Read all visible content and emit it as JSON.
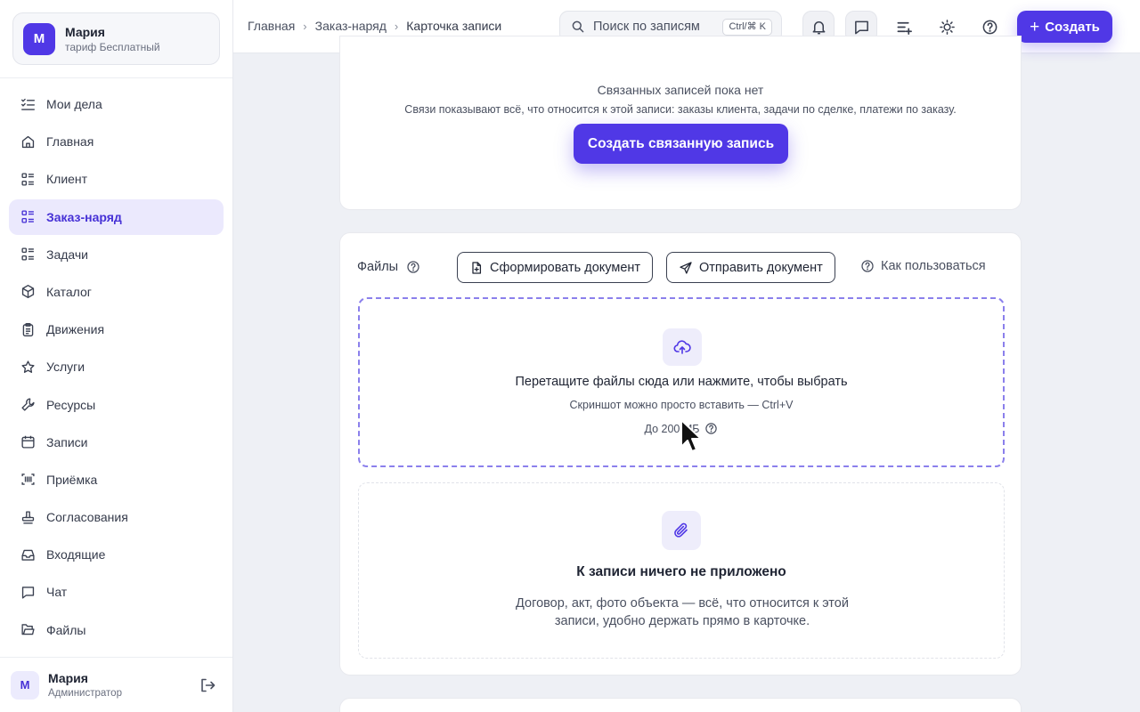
{
  "profile": {
    "initial": "М",
    "name": "Мария",
    "plan": "тариф Бесплатный"
  },
  "sidebar": {
    "items": [
      {
        "label": "Мои дела",
        "icon": "checklist-icon"
      },
      {
        "label": "Главная",
        "icon": "home-icon"
      },
      {
        "label": "Клиент",
        "icon": "list-icon"
      },
      {
        "label": "Заказ-наряд",
        "icon": "list-icon",
        "active": true
      },
      {
        "label": "Задачи",
        "icon": "list-icon"
      },
      {
        "label": "Каталог",
        "icon": "box-icon"
      },
      {
        "label": "Движения",
        "icon": "clipboard-icon"
      },
      {
        "label": "Услуги",
        "icon": "star-icon"
      },
      {
        "label": "Ресурсы",
        "icon": "wrench-icon"
      },
      {
        "label": "Записи",
        "icon": "calendar-icon"
      },
      {
        "label": "Приёмка",
        "icon": "scan-icon"
      },
      {
        "label": "Согласования",
        "icon": "stamp-icon"
      },
      {
        "label": "Входящие",
        "icon": "inbox-icon"
      },
      {
        "label": "Чат",
        "icon": "chat-icon"
      },
      {
        "label": "Файлы",
        "icon": "folder-icon"
      }
    ]
  },
  "footer": {
    "initial": "М",
    "name": "Мария",
    "role": "Администратор"
  },
  "breadcrumb": {
    "home": "Главная",
    "section": "Заказ-наряд",
    "current": "Карточка записи"
  },
  "search": {
    "placeholder": "Поиск по записям",
    "shortcut": "Ctrl/⌘ K"
  },
  "toolbar": {
    "create_label": "Создать"
  },
  "related": {
    "title": "Связанных записей пока нет",
    "description": "Связи показывают всё, что относится к этой записи: заказы клиента, задачи по сделке, платежи по заказу.",
    "button": "Создать связанную запись"
  },
  "files": {
    "title": "Файлы",
    "generate_button": "Сформировать документ",
    "send_button": "Отправить документ",
    "howto": "Как пользоваться",
    "dropzone_title": "Перетащите файлы сюда или нажмите, чтобы выбрать",
    "dropzone_sub": "Скриншот можно просто вставить — Ctrl+V",
    "dropzone_limit": "До 200 МБ",
    "empty_title": "К записи ничего не приложено",
    "empty_desc": "Договор, акт, фото объекта — всё, что относится к этой записи, удобно держать прямо в карточке."
  },
  "colors": {
    "accent": "#5038e6",
    "active_bg": "#ebe9fd",
    "page_bg": "#eef0f5"
  }
}
